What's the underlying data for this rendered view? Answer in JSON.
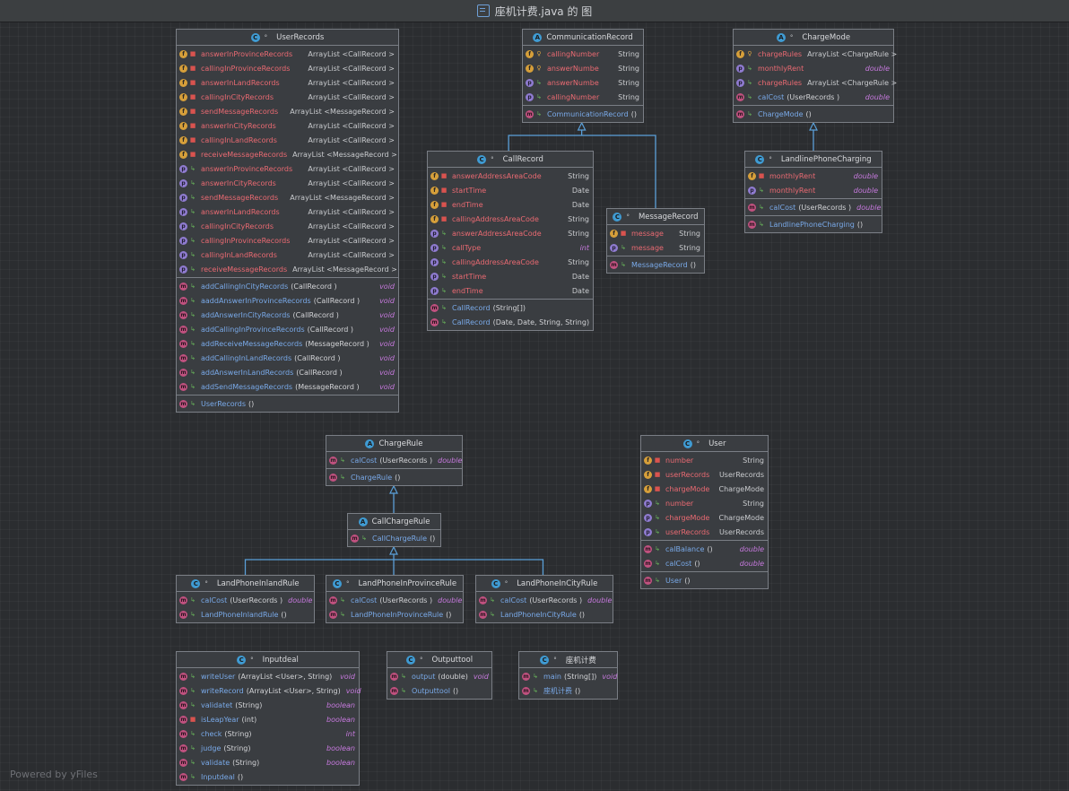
{
  "window": {
    "title": "座机计费.java 的 图"
  },
  "footer": {
    "text": "Powered by yFiles"
  },
  "nodes": [
    {
      "id": "UserRecords",
      "name": "UserRecords",
      "kind": "C",
      "visibility": "°",
      "sections": [
        [
          {
            "b": "f",
            "acc": "lock",
            "name": "answerInProvinceRecords",
            "type": "ArrayList <CallRecord >"
          },
          {
            "b": "f",
            "acc": "lock",
            "name": "callingInProvinceRecords",
            "type": "ArrayList <CallRecord >"
          },
          {
            "b": "f",
            "acc": "lock",
            "name": "answerInLandRecords",
            "type": "ArrayList <CallRecord >"
          },
          {
            "b": "f",
            "acc": "lock",
            "name": "callingInCityRecords",
            "type": "ArrayList <CallRecord >"
          },
          {
            "b": "f",
            "acc": "lock",
            "name": "sendMessageRecords",
            "type": "ArrayList <MessageRecord >"
          },
          {
            "b": "f",
            "acc": "lock",
            "name": "answerInCityRecords",
            "type": "ArrayList <CallRecord >"
          },
          {
            "b": "f",
            "acc": "lock",
            "name": "callingInLandRecords",
            "type": "ArrayList <CallRecord >"
          },
          {
            "b": "f",
            "acc": "lock",
            "name": "receiveMessageRecords",
            "type": "ArrayList <MessageRecord >"
          },
          {
            "b": "p",
            "acc": "pub",
            "name": "answerInProvinceRecords",
            "type": "ArrayList <CallRecord >"
          },
          {
            "b": "p",
            "acc": "pub",
            "name": "answerInCityRecords",
            "type": "ArrayList <CallRecord >"
          },
          {
            "b": "p",
            "acc": "pub",
            "name": "sendMessageRecords",
            "type": "ArrayList <MessageRecord >"
          },
          {
            "b": "p",
            "acc": "pub",
            "name": "answerInLandRecords",
            "type": "ArrayList <CallRecord >"
          },
          {
            "b": "p",
            "acc": "pub",
            "name": "callingInCityRecords",
            "type": "ArrayList <CallRecord >"
          },
          {
            "b": "p",
            "acc": "pub",
            "name": "callingInProvinceRecords",
            "type": "ArrayList <CallRecord >"
          },
          {
            "b": "p",
            "acc": "pub",
            "name": "callingInLandRecords",
            "type": "ArrayList <CallRecord >"
          },
          {
            "b": "p",
            "acc": "pub",
            "name": "receiveMessageRecords",
            "type": "ArrayList <MessageRecord >"
          }
        ],
        [
          {
            "b": "m",
            "acc": "pub",
            "name": "addCallingInCityRecords",
            "args": "(CallRecord )",
            "type": "void",
            "kw": true
          },
          {
            "b": "m",
            "acc": "pub",
            "name": "aaddAnswerInProvinceRecords",
            "args": "(CallRecord )",
            "type": "void",
            "kw": true
          },
          {
            "b": "m",
            "acc": "pub",
            "name": "addAnswerInCityRecords",
            "args": "(CallRecord )",
            "type": "void",
            "kw": true
          },
          {
            "b": "m",
            "acc": "pub",
            "name": "addCallingInProvinceRecords",
            "args": "(CallRecord )",
            "type": "void",
            "kw": true
          },
          {
            "b": "m",
            "acc": "pub",
            "name": "addReceiveMessageRecords",
            "args": "(MessageRecord )",
            "type": "void",
            "kw": true
          },
          {
            "b": "m",
            "acc": "pub",
            "name": "addCallingInLandRecords",
            "args": "(CallRecord )",
            "type": "void",
            "kw": true
          },
          {
            "b": "m",
            "acc": "pub",
            "name": "addAnswerInLandRecords",
            "args": "(CallRecord )",
            "type": "void",
            "kw": true
          },
          {
            "b": "m",
            "acc": "pub",
            "name": "addSendMessageRecords",
            "args": "(MessageRecord )",
            "type": "void",
            "kw": true
          }
        ],
        [
          {
            "b": "m",
            "acc": "pub",
            "name": "UserRecords",
            "args": "()",
            "type": ""
          }
        ]
      ]
    },
    {
      "id": "CommunicationRecord",
      "name": "CommunicationRecord",
      "kind": "A",
      "visibility": "",
      "sections": [
        [
          {
            "b": "f",
            "acc": "pkg",
            "name": "callingNumber",
            "type": "String"
          },
          {
            "b": "f",
            "acc": "pkg",
            "name": "answerNumbe",
            "type": "String"
          },
          {
            "b": "p",
            "acc": "pub",
            "name": "answerNumbe",
            "type": "String"
          },
          {
            "b": "p",
            "acc": "pub",
            "name": "callingNumber",
            "type": "String"
          }
        ],
        [
          {
            "b": "m",
            "acc": "pub",
            "name": "CommunicationRecord",
            "args": "()",
            "type": ""
          }
        ]
      ]
    },
    {
      "id": "ChargeMode",
      "name": "ChargeMode",
      "kind": "A",
      "visibility": "°",
      "sections": [
        [
          {
            "b": "f",
            "acc": "pkg",
            "name": "chargeRules",
            "type": "ArrayList <ChargeRule >"
          },
          {
            "b": "p",
            "acc": "pub",
            "name": "monthlyRent",
            "type": "double",
            "kw": true
          },
          {
            "b": "p",
            "acc": "pub",
            "name": "chargeRules",
            "type": "ArrayList <ChargeRule >"
          },
          {
            "b": "ab",
            "acc": "pub",
            "name": "calCost",
            "args": "(UserRecords )",
            "type": "double",
            "kw": true
          }
        ],
        [
          {
            "b": "m",
            "acc": "pub",
            "name": "ChargeMode",
            "args": "()",
            "type": ""
          }
        ]
      ]
    },
    {
      "id": "CallRecord",
      "name": "CallRecord",
      "kind": "C",
      "visibility": "°",
      "sections": [
        [
          {
            "b": "f",
            "acc": "lock",
            "name": "answerAddressAreaCode",
            "type": "String"
          },
          {
            "b": "f",
            "acc": "lock",
            "name": "startTime",
            "type": "Date"
          },
          {
            "b": "f",
            "acc": "lock",
            "name": "endTime",
            "type": "Date"
          },
          {
            "b": "f",
            "acc": "lock",
            "name": "callingAddressAreaCode",
            "type": "String"
          },
          {
            "b": "p",
            "acc": "pub",
            "name": "answerAddressAreaCode",
            "type": "String"
          },
          {
            "b": "p",
            "acc": "pub",
            "name": "callType",
            "type": "int",
            "kw": true
          },
          {
            "b": "p",
            "acc": "pub",
            "name": "callingAddressAreaCode",
            "type": "String"
          },
          {
            "b": "p",
            "acc": "pub",
            "name": "startTime",
            "type": "Date"
          },
          {
            "b": "p",
            "acc": "pub",
            "name": "endTime",
            "type": "Date"
          }
        ],
        [
          {
            "b": "m",
            "acc": "pub",
            "name": "CallRecord",
            "args": "(String[])",
            "type": ""
          },
          {
            "b": "m",
            "acc": "pub",
            "name": "CallRecord",
            "args": "(Date, Date, String, String)",
            "type": ""
          }
        ]
      ]
    },
    {
      "id": "MessageRecord",
      "name": "MessageRecord",
      "kind": "C",
      "visibility": "°",
      "sections": [
        [
          {
            "b": "f",
            "acc": "lock",
            "name": "message",
            "type": "String"
          },
          {
            "b": "p",
            "acc": "pub",
            "name": "message",
            "type": "String"
          }
        ],
        [
          {
            "b": "m",
            "acc": "pub",
            "name": "MessageRecord",
            "args": "()",
            "type": ""
          }
        ]
      ]
    },
    {
      "id": "LandlinePhoneCharging",
      "name": "LandlinePhoneCharging",
      "kind": "C",
      "visibility": "°",
      "sections": [
        [
          {
            "b": "f",
            "acc": "lock",
            "name": "monthlyRent",
            "type": "double",
            "kw": true
          },
          {
            "b": "p",
            "acc": "pub",
            "name": "monthlyRent",
            "type": "double",
            "kw": true
          }
        ],
        [
          {
            "b": "m",
            "acc": "pub",
            "name": "calCost",
            "args": "(UserRecords )",
            "type": "double",
            "kw": true
          }
        ],
        [
          {
            "b": "m",
            "acc": "pub",
            "name": "LandlinePhoneCharging",
            "args": "()",
            "type": ""
          }
        ]
      ]
    },
    {
      "id": "ChargeRule",
      "name": "ChargeRule",
      "kind": "A",
      "visibility": "",
      "sections": [
        [
          {
            "b": "ab",
            "acc": "pub",
            "name": "calCost",
            "args": "(UserRecords )",
            "type": "double",
            "kw": true
          }
        ],
        [
          {
            "b": "m",
            "acc": "pub",
            "name": "ChargeRule",
            "args": "()",
            "type": ""
          }
        ]
      ]
    },
    {
      "id": "CallChargeRule",
      "name": "CallChargeRule",
      "kind": "A",
      "visibility": "",
      "sections": [
        [
          {
            "b": "m",
            "acc": "pub",
            "name": "CallChargeRule",
            "args": "()",
            "type": ""
          }
        ]
      ]
    },
    {
      "id": "LandPhoneInlandRule",
      "name": "LandPhoneInlandRule",
      "kind": "C",
      "visibility": "°",
      "sections": [
        [
          {
            "b": "m",
            "acc": "pub",
            "name": "calCost",
            "args": "(UserRecords )",
            "type": "double",
            "kw": true
          },
          {
            "b": "m",
            "acc": "pub",
            "name": "LandPhoneInlandRule",
            "args": "()",
            "type": ""
          }
        ]
      ]
    },
    {
      "id": "LandPhoneInProvinceRule",
      "name": "LandPhoneInProvinceRule",
      "kind": "C",
      "visibility": "°",
      "sections": [
        [
          {
            "b": "m",
            "acc": "pub",
            "name": "calCost",
            "args": "(UserRecords )",
            "type": "double",
            "kw": true
          },
          {
            "b": "m",
            "acc": "pub",
            "name": "LandPhoneInProvinceRule",
            "args": "()",
            "type": ""
          }
        ]
      ]
    },
    {
      "id": "LandPhoneInCityRule",
      "name": "LandPhoneInCityRule",
      "kind": "C",
      "visibility": "°",
      "sections": [
        [
          {
            "b": "m",
            "acc": "pub",
            "name": "calCost",
            "args": "(UserRecords )",
            "type": "double",
            "kw": true
          },
          {
            "b": "m",
            "acc": "pub",
            "name": "LandPhoneInCityRule",
            "args": "()",
            "type": ""
          }
        ]
      ]
    },
    {
      "id": "User",
      "name": "User",
      "kind": "C",
      "visibility": "°",
      "sections": [
        [
          {
            "b": "f",
            "acc": "lock",
            "name": "number",
            "type": "String"
          },
          {
            "b": "f",
            "acc": "lock",
            "name": "userRecords",
            "type": "UserRecords"
          },
          {
            "b": "f",
            "acc": "lock",
            "name": "chargeMode",
            "type": "ChargeMode"
          },
          {
            "b": "p",
            "acc": "pub",
            "name": "number",
            "type": "String"
          },
          {
            "b": "p",
            "acc": "pub",
            "name": "chargeMode",
            "type": "ChargeMode"
          },
          {
            "b": "p",
            "acc": "pub",
            "name": "userRecords",
            "type": "UserRecords"
          }
        ],
        [
          {
            "b": "m",
            "acc": "pub",
            "name": "calBalance",
            "args": "()",
            "type": "double",
            "kw": true
          },
          {
            "b": "m",
            "acc": "pub",
            "name": "calCost",
            "args": "()",
            "type": "double",
            "kw": true
          }
        ],
        [
          {
            "b": "m",
            "acc": "pub",
            "name": "User",
            "args": "()",
            "type": ""
          }
        ]
      ]
    },
    {
      "id": "Inputdeal",
      "name": "Inputdeal",
      "kind": "C",
      "visibility": "°",
      "sections": [
        [
          {
            "b": "m",
            "acc": "pub",
            "name": "writeUser",
            "args": "(ArrayList <User>, String)",
            "type": "void",
            "kw": true
          },
          {
            "b": "m",
            "acc": "pub",
            "name": "writeRecord",
            "args": "(ArrayList <User>, String)",
            "type": "void",
            "kw": true
          },
          {
            "b": "m",
            "acc": "pub",
            "name": "validatet",
            "args": "(String)",
            "type": "boolean",
            "kw": true
          },
          {
            "b": "m",
            "acc": "lock",
            "name": "isLeapYear",
            "args": "(int)",
            "type": "boolean",
            "kw": true
          },
          {
            "b": "m",
            "acc": "pub",
            "name": "check",
            "args": "(String)",
            "type": "int",
            "kw": true
          },
          {
            "b": "m",
            "acc": "pub",
            "name": "judge",
            "args": "(String)",
            "type": "boolean",
            "kw": true
          },
          {
            "b": "m",
            "acc": "pub",
            "name": "validate",
            "args": "(String)",
            "type": "boolean",
            "kw": true
          },
          {
            "b": "m",
            "acc": "pub",
            "name": "Inputdeal",
            "args": "()",
            "type": ""
          }
        ]
      ]
    },
    {
      "id": "Outputtool",
      "name": "Outputtool",
      "kind": "C",
      "visibility": "°",
      "sections": [
        [
          {
            "b": "m",
            "acc": "pub",
            "name": "output",
            "args": "(double)",
            "type": "void",
            "kw": true
          },
          {
            "b": "m",
            "acc": "pub",
            "name": "Outputtool",
            "args": "()",
            "type": ""
          }
        ]
      ]
    },
    {
      "id": "Main",
      "name": "座机计费",
      "kind": "C",
      "visibility": "°",
      "sections": [
        [
          {
            "b": "m",
            "acc": "pub",
            "name": "main",
            "args": "(String[])",
            "type": "void",
            "kw": true
          },
          {
            "b": "m",
            "acc": "pub",
            "name": "座机计费",
            "args": "()",
            "type": ""
          }
        ]
      ]
    }
  ]
}
